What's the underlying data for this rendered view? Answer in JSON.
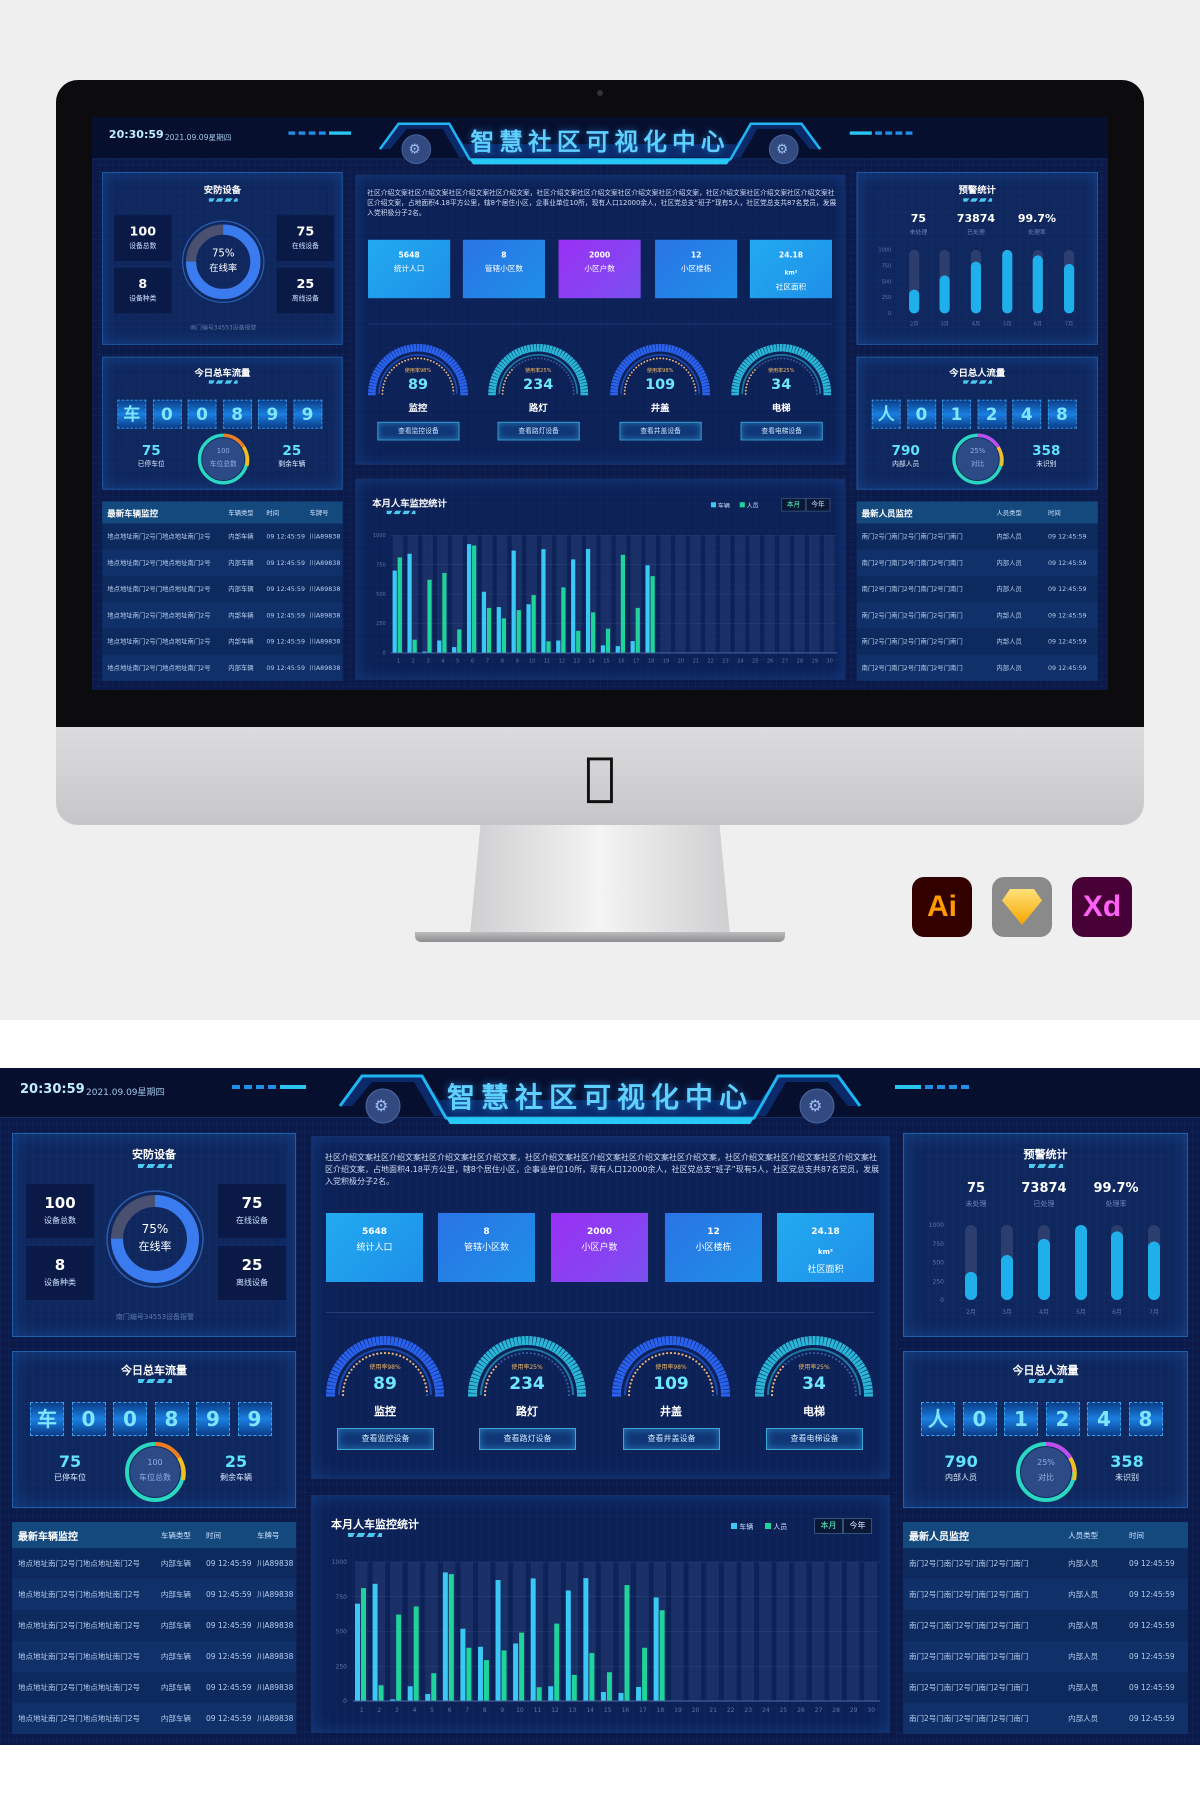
{
  "header": {
    "time": "20:30:59",
    "date": "2021.09.09星期四",
    "title": "智慧社区可视化中心"
  },
  "security": {
    "title": "安防设备",
    "total": {
      "value": "100",
      "label": "设备总数"
    },
    "types": {
      "value": "8",
      "label": "设备种类"
    },
    "online": {
      "value": "75",
      "label": "在线设备"
    },
    "offline": {
      "value": "25",
      "label": "离线设备"
    },
    "ring": {
      "percent": "75%",
      "label": "在线率",
      "fraction": 0.75,
      "colors": [
        "#1aa8f0",
        "#6a3cf0"
      ]
    },
    "footer": "南门编号34553设备报警"
  },
  "vehicle_flow": {
    "title": "今日总车流量",
    "digits": [
      "车",
      "0",
      "0",
      "8",
      "9",
      "9"
    ],
    "left": {
      "value": "75",
      "label": "已停车位"
    },
    "ring": {
      "value": "100",
      "label": "车位总数"
    },
    "right": {
      "value": "25",
      "label": "剩余车辆"
    }
  },
  "vehicle_table": {
    "headers": [
      "最新车辆监控",
      "车辆类型",
      "时间",
      "车牌号"
    ],
    "rows": [
      [
        "地点地址南门2号门地点地址南门2号",
        "内部车辆",
        "09 12:45:59",
        "川A89838"
      ],
      [
        "地点地址南门2号门地点地址南门2号",
        "内部车辆",
        "09 12:45:59",
        "川A89838"
      ],
      [
        "地点地址南门2号门地点地址南门2号",
        "内部车辆",
        "09 12:45:59",
        "川A89838"
      ],
      [
        "地点地址南门2号门地点地址南门2号",
        "内部车辆",
        "09 12:45:59",
        "川A89838"
      ],
      [
        "地点地址南门2号门地点地址南门2号",
        "内部车辆",
        "09 12:45:59",
        "川A89838"
      ],
      [
        "地点地址南门2号门地点地址南门2号",
        "内部车辆",
        "09 12:45:59",
        "川A89838"
      ]
    ]
  },
  "intro": {
    "text": "社区介绍文案社区介绍文案社区介绍文案社区介绍文案，社区介绍文案社区介绍文案社区介绍文案社区介绍文案，社区介绍文案社区介绍文案社区介绍文案社区介绍文案，占地面积4.18平方公里，辖8个居住小区，企事业单位10所，现有人口12000余人，社区党总支“班子”现有5人，社区党总支共87名党员，发展入党积极分子2名。"
  },
  "stats": [
    {
      "value": "5648",
      "unit": "",
      "label": "统计人口",
      "color": "#22aaf0"
    },
    {
      "value": "8",
      "unit": "",
      "label": "管辖小区数",
      "color": "#2a74e4"
    },
    {
      "value": "2000",
      "unit": "",
      "label": "小区户数",
      "color": "#9a30f4"
    },
    {
      "value": "12",
      "unit": "",
      "label": "小区楼栋",
      "color": "#2a74e4"
    },
    {
      "value": "24.18",
      "unit": "km²",
      "label": "社区面积",
      "color": "#22aaf0"
    }
  ],
  "gauges": [
    {
      "usage": "使用率98%",
      "fraction": 0.98,
      "value": "89",
      "name": "监控",
      "button": "查看监控设备",
      "color": "#2a62f0"
    },
    {
      "usage": "使用率25%",
      "fraction": 0.25,
      "value": "234",
      "name": "路灯",
      "button": "查看路灯设备",
      "color": "#2ab6d6"
    },
    {
      "usage": "使用率98%",
      "fraction": 0.98,
      "value": "109",
      "name": "井盖",
      "button": "查看井盖设备",
      "color": "#2a62f0"
    },
    {
      "usage": "使用率25%",
      "fraction": 0.25,
      "value": "34",
      "name": "电梯",
      "button": "查看电梯设备",
      "color": "#2ab6d6"
    }
  ],
  "warning": {
    "title": "预警统计",
    "stats": [
      {
        "value": "75",
        "label": "未处理"
      },
      {
        "value": "73874",
        "label": "已处理"
      },
      {
        "value": "99.7%",
        "label": "处理率"
      }
    ]
  },
  "people_flow": {
    "title": "今日总人流量",
    "digits": [
      "人",
      "0",
      "1",
      "2",
      "4",
      "8"
    ],
    "left": {
      "value": "790",
      "label": "内部人员"
    },
    "ring": {
      "value": "25%",
      "label": "对比"
    },
    "right": {
      "value": "358",
      "label": "未识别"
    }
  },
  "people_table": {
    "headers": [
      "最新人员监控",
      "人员类型",
      "时间"
    ],
    "rows": [
      [
        "南门2号门南门2号门南门2号门南门",
        "内部人员",
        "09 12:45:59"
      ],
      [
        "南门2号门南门2号门南门2号门南门",
        "内部人员",
        "09 12:45:59"
      ],
      [
        "南门2号门南门2号门南门2号门南门",
        "内部人员",
        "09 12:45:59"
      ],
      [
        "南门2号门南门2号门南门2号门南门",
        "内部人员",
        "09 12:45:59"
      ],
      [
        "南门2号门南门2号门南门2号门南门",
        "内部人员",
        "09 12:45:59"
      ],
      [
        "南门2号门南门2号门南门2号门南门",
        "内部人员",
        "09 12:45:59"
      ]
    ]
  },
  "chart_data": [
    {
      "type": "bar",
      "title": "本月人车监控统计",
      "toggle": [
        "本月",
        "今年"
      ],
      "legend_position": "top-right",
      "grid": true,
      "categories": [
        "1",
        "2",
        "3",
        "4",
        "5",
        "6",
        "7",
        "8",
        "9",
        "10",
        "11",
        "12",
        "13",
        "14",
        "15",
        "16",
        "17",
        "18",
        "19",
        "20",
        "21",
        "22",
        "23",
        "24",
        "25",
        "26",
        "27",
        "28",
        "29",
        "30"
      ],
      "yticks": [
        "0",
        "250",
        "500",
        "750",
        "1000"
      ],
      "ylim": [
        0,
        1000
      ],
      "series": [
        {
          "name": "车辆",
          "color": "#3cc8f5",
          "values": [
            700,
            843,
            12,
            106,
            50,
            925,
            520,
            390,
            870,
            414,
            882,
            106,
            795,
            884,
            65,
            58,
            101,
            745,
            null,
            null,
            null,
            null,
            null,
            null,
            null,
            null,
            null,
            null,
            null,
            null
          ]
        },
        {
          "name": "人员",
          "color": "#1fd39a",
          "values": [
            812,
            113,
            622,
            680,
            200,
            913,
            383,
            294,
            364,
            492,
            99,
            557,
            188,
            345,
            207,
            834,
            383,
            653,
            null,
            null,
            null,
            null,
            null,
            null,
            null,
            null,
            null,
            null,
            null,
            null
          ]
        }
      ]
    },
    {
      "type": "bar",
      "categories": [
        "2月",
        "3月",
        "4月",
        "5月",
        "6月",
        "7月"
      ],
      "yticks": [
        "0",
        "250",
        "500",
        "750",
        "1000"
      ],
      "ylim": [
        0,
        1000
      ],
      "values": [
        375,
        600,
        815,
        1000,
        915,
        780
      ],
      "color": "#1fb0ec"
    }
  ],
  "mockup": {
    "badges": [
      "Ai",
      "Xd"
    ]
  }
}
